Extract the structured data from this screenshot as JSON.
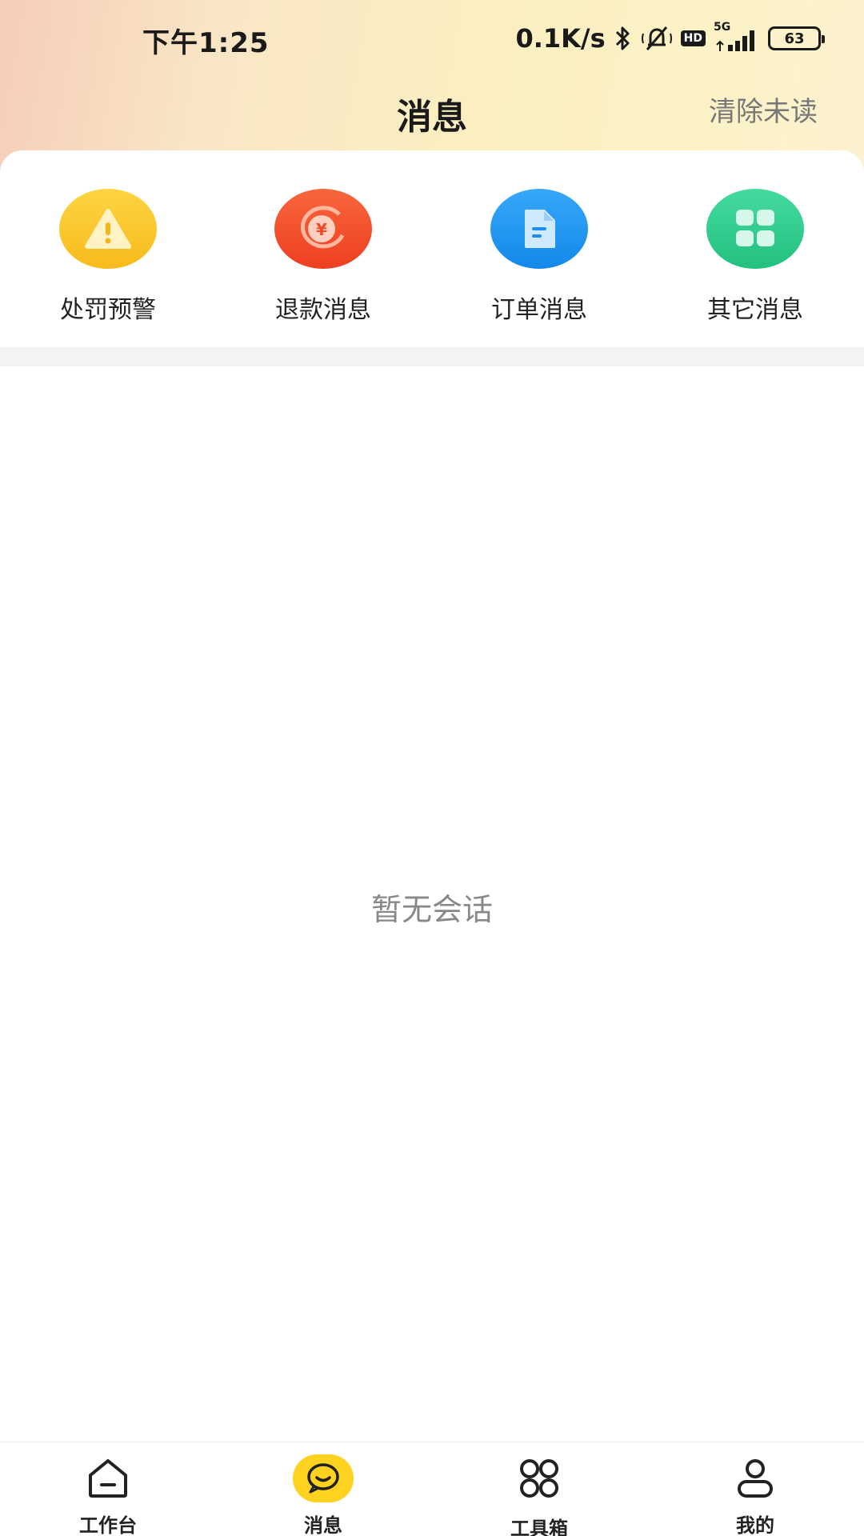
{
  "status_bar": {
    "time": "下午1:25",
    "speed": "0.1K/s",
    "network": "5G",
    "hd": "HD",
    "battery": "63"
  },
  "header": {
    "title": "消息",
    "clear_unread": "清除未读"
  },
  "categories": [
    {
      "label": "处罚预警",
      "icon": "warning-icon",
      "color": "#fbc82e"
    },
    {
      "label": "退款消息",
      "icon": "refund-icon",
      "color": "#f4532c"
    },
    {
      "label": "订单消息",
      "icon": "order-document-icon",
      "color": "#1e96f2"
    },
    {
      "label": "其它消息",
      "icon": "grid-icon",
      "color": "#2fd08f"
    }
  ],
  "empty_state": "暂无会话",
  "tabbar": [
    {
      "label": "工作台",
      "icon": "home-icon"
    },
    {
      "label": "消息",
      "icon": "chat-icon",
      "active": true,
      "accent": "#ffd21f"
    },
    {
      "label": "工具箱",
      "icon": "toolbox-icon"
    },
    {
      "label": "我的",
      "icon": "profile-icon"
    }
  ]
}
